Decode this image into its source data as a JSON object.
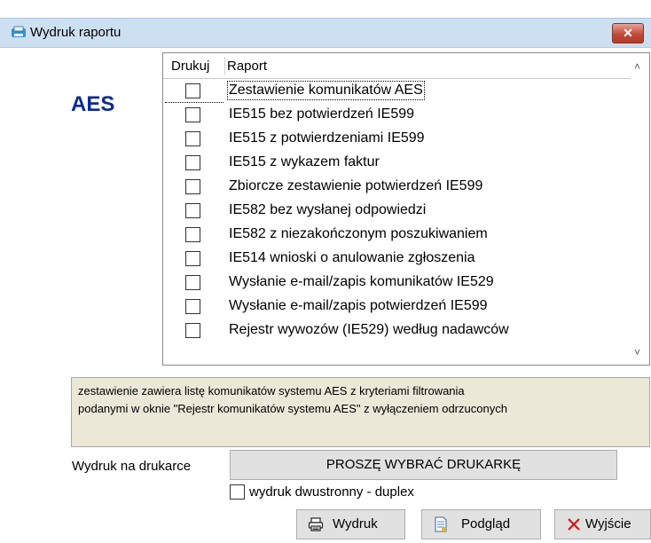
{
  "window": {
    "title": "Wydruk raportu",
    "close_label": "✕"
  },
  "section_label": "AES",
  "list": {
    "headers": {
      "print": "Drukuj",
      "report": "Raport"
    },
    "rows": [
      {
        "label": "Zestawienie komunikatów AES",
        "checked": false
      },
      {
        "label": "IE515 bez potwierdzeń IE599",
        "checked": false
      },
      {
        "label": "IE515 z potwierdzeniami IE599",
        "checked": false
      },
      {
        "label": "IE515 z wykazem faktur",
        "checked": false
      },
      {
        "label": "Zbiorcze zestawienie potwierdzeń IE599",
        "checked": false
      },
      {
        "label": "IE582 bez wysłanej odpowiedzi",
        "checked": false
      },
      {
        "label": "IE582 z niezakończonym poszukiwaniem",
        "checked": false
      },
      {
        "label": "IE514 wnioski o anulowanie zgłoszenia",
        "checked": false
      },
      {
        "label": "Wysłanie e-mail/zapis komunikatów IE529",
        "checked": false
      },
      {
        "label": "Wysłanie e-mail/zapis potwierdzeń IE599",
        "checked": false
      },
      {
        "label": "Rejestr wywozów (IE529) według nadawców",
        "checked": false
      }
    ]
  },
  "description": {
    "line1": "zestawienie zawiera listę komunikatów systemu AES z kryteriami filtrowania",
    "line2": "podanymi w oknie \"Rejestr komunikatów systemu AES\" z wyłączeniem odrzuconych"
  },
  "printer": {
    "label": "Wydruk na drukarce",
    "button": "PROSZĘ WYBRAĆ DRUKARKĘ"
  },
  "duplex": {
    "label": "wydruk dwustronny - duplex",
    "checked": false
  },
  "buttons": {
    "print": "Wydruk",
    "preview": "Podgląd",
    "exit": "Wyjście"
  },
  "icons": {
    "app": "report-icon",
    "print": "printer-icon",
    "preview": "document-preview-icon",
    "exit": "red-x-icon"
  }
}
